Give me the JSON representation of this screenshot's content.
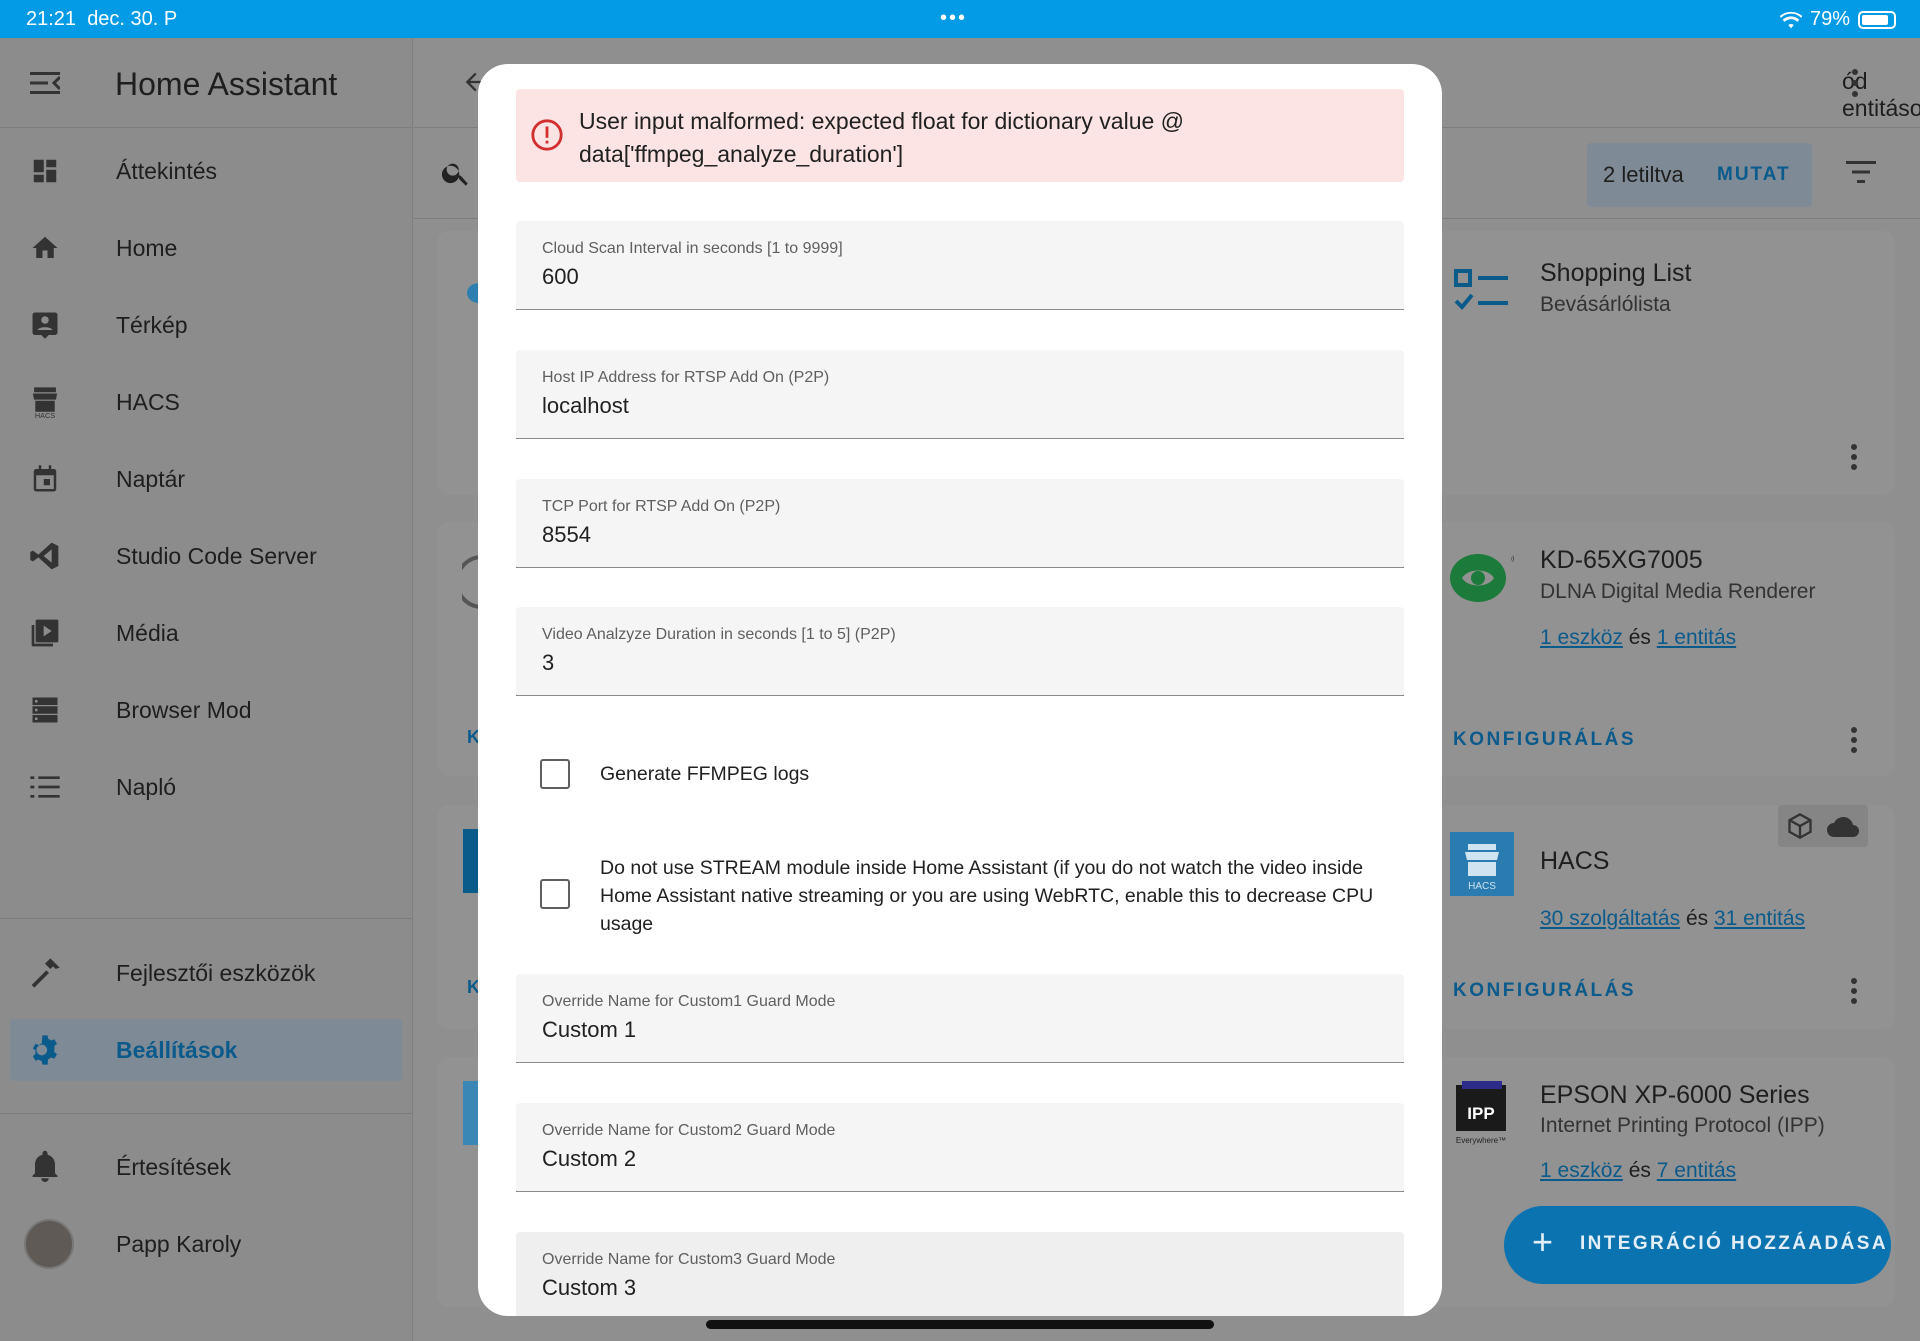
{
  "status_bar": {
    "time": "21:21",
    "date": "dec. 30. P",
    "battery": "79%"
  },
  "sidebar": {
    "title": "Home Assistant",
    "items": [
      {
        "label": "Áttekintés",
        "icon": "dashboard-icon"
      },
      {
        "label": "Home",
        "icon": "home-icon"
      },
      {
        "label": "Térkép",
        "icon": "map-icon"
      },
      {
        "label": "HACS",
        "icon": "hacs-icon"
      },
      {
        "label": "Naptár",
        "icon": "calendar-icon"
      },
      {
        "label": "Studio Code Server",
        "icon": "vscode-icon"
      },
      {
        "label": "Média",
        "icon": "media-icon"
      },
      {
        "label": "Browser Mod",
        "icon": "server-icon"
      },
      {
        "label": "Napló",
        "icon": "list-icon"
      }
    ],
    "dev_tools": "Fejlesztői eszközök",
    "settings": "Beállítások",
    "notifications": "Értesítések",
    "user": "Papp Karoly"
  },
  "main": {
    "breadcrumb": "ód entitások",
    "disabled_count": "2 letiltva",
    "show_label": "MUTAT",
    "cards": [
      {
        "title": "Shopping List",
        "subtitle": "Bevásárlólista"
      },
      {
        "title": "KD-65XG7005",
        "subtitle": "DLNA Digital Media Renderer",
        "link1": "1 eszköz",
        "and": "és",
        "link2": "1 entitás",
        "configure": "KONFIGURÁLÁS"
      },
      {
        "title": "HACS",
        "link1": "30 szolgáltatás",
        "and": "és",
        "link2": "31 entitás",
        "configure": "KONFIGURÁLÁS"
      },
      {
        "title": "EPSON XP-6000 Series",
        "subtitle": "Internet Printing Protocol (IPP)",
        "link1": "1 eszköz",
        "and": "és",
        "link2": "7 entitás"
      }
    ],
    "left_card_letter": "K",
    "fab_label": "INTEGRÁCIÓ HOZZÁADÁSA"
  },
  "dialog": {
    "error": "User input malformed: expected float for dictionary value @ data['ffmpeg_analyze_duration']",
    "fields": [
      {
        "label": "Cloud Scan Interval in seconds [1 to 9999]",
        "value": "600"
      },
      {
        "label": "Host IP Address for RTSP Add On (P2P)",
        "value": "localhost"
      },
      {
        "label": "TCP Port for RTSP Add On (P2P)",
        "value": "8554"
      },
      {
        "label": "Video Analzyze Duration in seconds [1 to 5] (P2P)",
        "value": "3"
      }
    ],
    "checkbox1": "Generate FFMPEG logs",
    "checkbox2": "Do not use STREAM module inside Home Assistant (if you do not watch the video inside Home Assistant native streaming or you are using WebRTC, enable this to decrease CPU usage",
    "fields2": [
      {
        "label": "Override Name for Custom1 Guard Mode",
        "value": "Custom 1"
      },
      {
        "label": "Override Name for Custom2 Guard Mode",
        "value": "Custom 2"
      },
      {
        "label": "Override Name for Custom3 Guard Mode",
        "value": "Custom 3"
      }
    ]
  }
}
